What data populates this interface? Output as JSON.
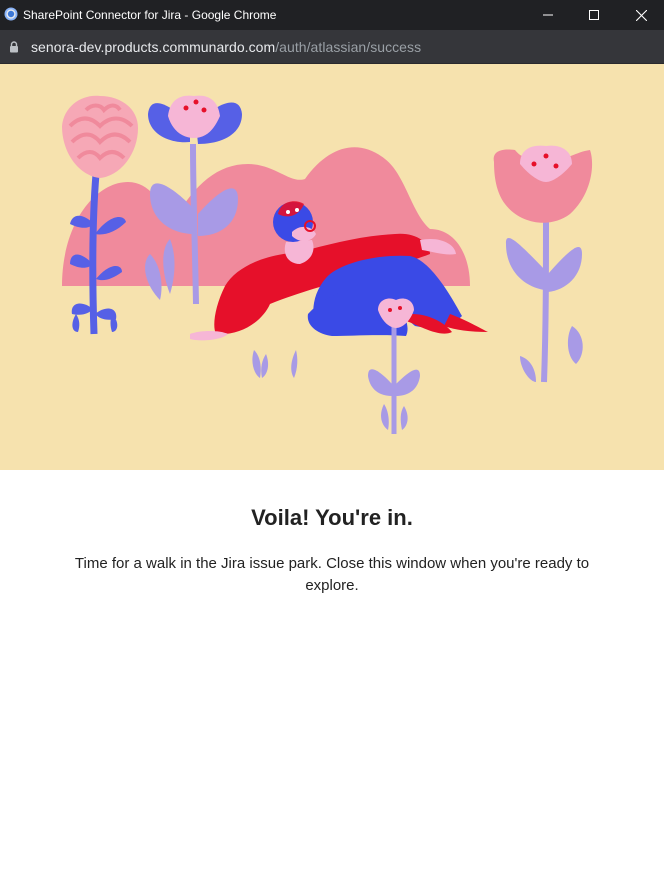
{
  "window": {
    "title": "SharePoint Connector for Jira - Google Chrome",
    "icon": "chrome-app-icon",
    "controls": [
      "minimize-icon",
      "maximize-icon",
      "close-icon"
    ]
  },
  "address_bar": {
    "host": "senora-dev.products.communardo.com",
    "path": "/auth/atlassian/success",
    "icon": "lock-icon"
  },
  "page": {
    "illustration": "flowers-and-reclining-person-illustration",
    "heading": "Voila! You're in.",
    "message": "Time for a walk in the Jira issue park. Close this window when you're ready to explore."
  },
  "colors": {
    "hero_background": "#f6e2ae",
    "pink": "#f08a9c",
    "blue": "#4a55e6",
    "lavender": "#a89ae6",
    "red": "#e6102a"
  }
}
